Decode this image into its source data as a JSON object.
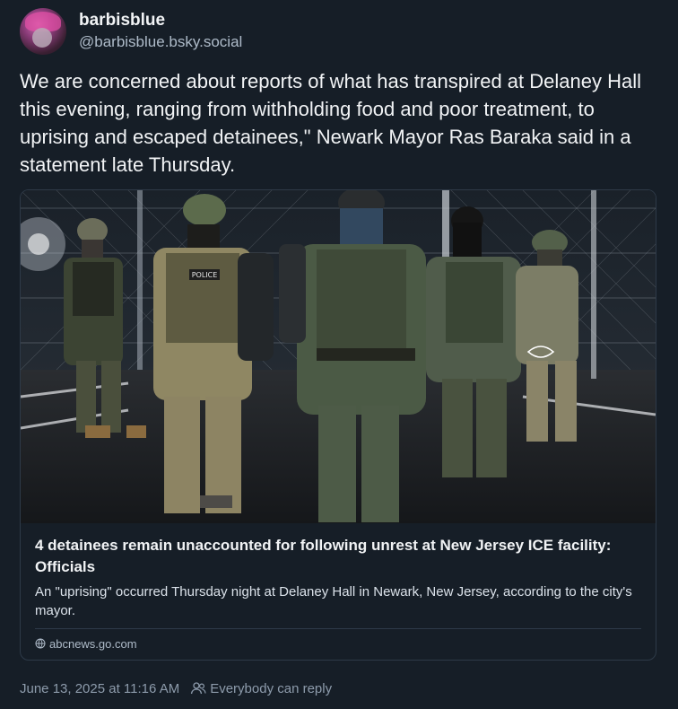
{
  "author": {
    "display_name": "barbisblue",
    "handle": "@barbisblue.bsky.social"
  },
  "post": {
    "text": "We are concerned about reports of what has transpired at Delaney Hall this evening, ranging from withholding food and poor treatment, to uprising and escaped detainees,\" Newark Mayor Ras Baraka said in a statement late Thursday."
  },
  "embed": {
    "image_icon": "photo-of-armed-officers",
    "title": "4 detainees remain unaccounted for following unrest at New Jersey ICE facility: Officials",
    "description": "An \"uprising\" occurred Thursday night at Delaney Hall in Newark, New Jersey, according to the city's mayor.",
    "domain": "abcnews.go.com"
  },
  "meta": {
    "timestamp": "June 13, 2025 at 11:16 AM",
    "reply_setting": "Everybody can reply"
  },
  "colors": {
    "background": "#161e27",
    "text": "#f1f3f5",
    "muted": "#8d9bab",
    "border": "#2e3a48"
  }
}
